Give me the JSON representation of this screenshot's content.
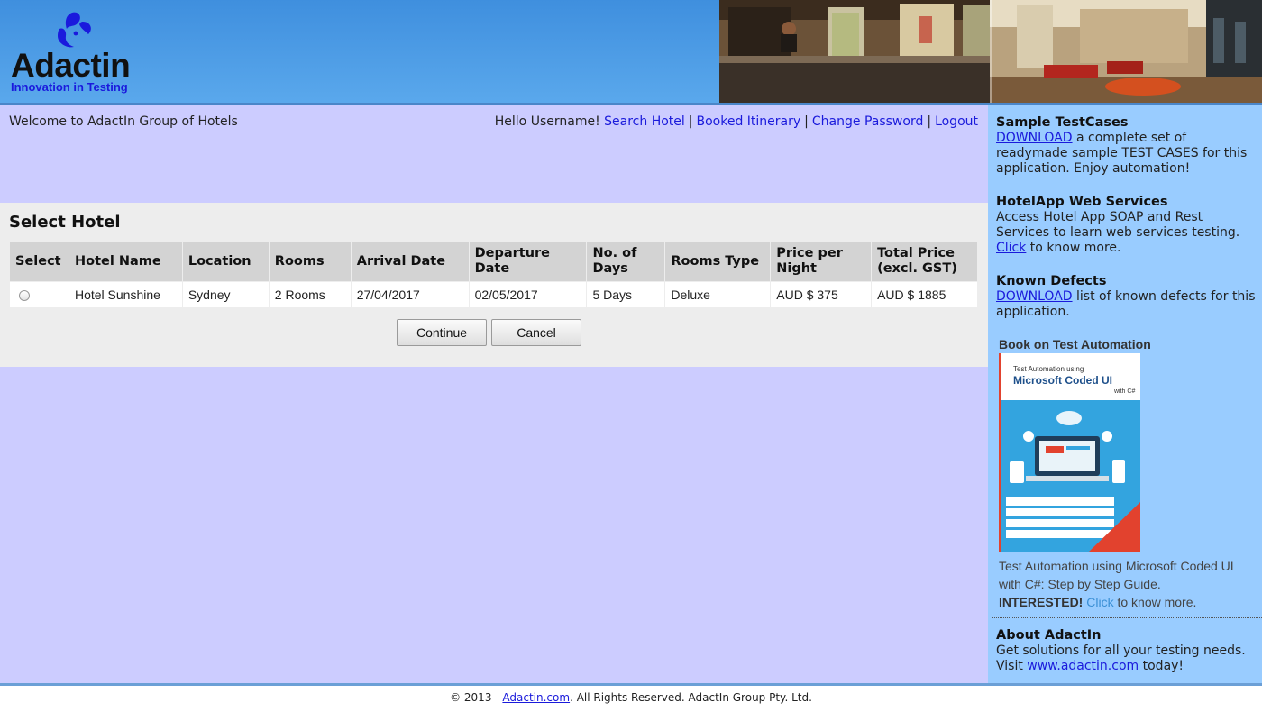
{
  "brand": {
    "name": "Adactin",
    "tagline": "Innovation in Testing",
    "accent": "#1a1add"
  },
  "header": {
    "welcome": "Welcome to AdactIn Group of Hotels",
    "greeting": "Hello Username!",
    "nav": {
      "search_hotel": "Search Hotel",
      "booked_itinerary": "Booked Itinerary",
      "change_password": "Change Password",
      "logout": "Logout"
    },
    "separator": "|"
  },
  "select_hotel": {
    "title": "Select Hotel",
    "columns": [
      "Select",
      "Hotel Name",
      "Location",
      "Rooms",
      "Arrival Date",
      "Departure Date",
      "No. of Days",
      "Rooms Type",
      "Price per Night",
      "Total Price (excl. GST)"
    ],
    "rows": [
      {
        "selected": false,
        "hotel_name": "Hotel Sunshine",
        "location": "Sydney",
        "rooms": "2 Rooms",
        "arrival_date": "27/04/2017",
        "departure_date": "02/05/2017",
        "days": "5 Days",
        "room_type": "Deluxe",
        "price_per_night": "AUD $ 375",
        "total_price": "AUD $ 1885"
      }
    ],
    "continue_label": "Continue",
    "cancel_label": "Cancel"
  },
  "sidebar": {
    "testcases": {
      "title": "Sample TestCases",
      "link": "DOWNLOAD",
      "text": " a complete set of readymade sample TEST CASES for this application. Enjoy automation!"
    },
    "webservices": {
      "title": "HotelApp Web Services",
      "text": "Access Hotel App SOAP and Rest Services to learn web services testing. ",
      "link": "Click",
      "text_after": " to know more."
    },
    "defects": {
      "title": "Known Defects",
      "link": "DOWNLOAD",
      "text": " list of known defects for this application."
    },
    "book": {
      "title": "Book on Test Automation",
      "cover_line1": "Test Automation using",
      "cover_line2": "Microsoft Coded UI",
      "cover_line3": "with C#",
      "description": "Test Automation using Microsoft Coded UI with C#: Step by Step Guide.",
      "interested": "INTERESTED!",
      "link": "Click",
      "text_after": " to know more."
    },
    "about": {
      "title": "About AdactIn",
      "text": "Get solutions for all your testing needs. Visit ",
      "link": "www.adactin.com",
      "text_after": " today!"
    }
  },
  "footer": {
    "prefix": "© 2013 - ",
    "link": "Adactin.com",
    "suffix": ". All Rights Reserved. AdactIn Group Pty. Ltd."
  }
}
